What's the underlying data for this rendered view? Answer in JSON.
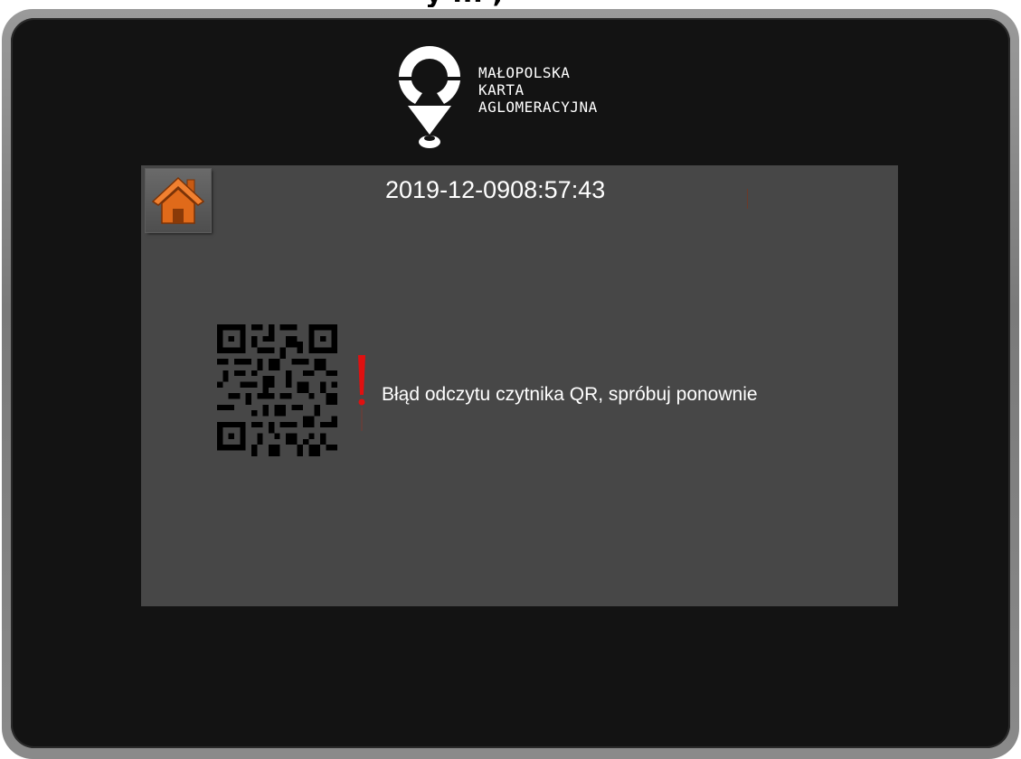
{
  "header_fragment": "y ... ,",
  "brand": {
    "lines": [
      "MAŁOPOLSKA",
      "KARTA",
      "AGLOMERACYJNA"
    ]
  },
  "status": {
    "date": "2019-12-09",
    "time": "08:57:43"
  },
  "error": {
    "message": "Błąd odczytu czytnika QR, spróbuj ponownie"
  },
  "icons": {
    "home": "home-icon",
    "qr": "qr-code-icon",
    "warning": "exclamation-icon",
    "logo": "map-pin-logo-icon"
  },
  "colors": {
    "panel": "#474747",
    "frame": "#131313",
    "home_accent": "#e06a1a",
    "warning": "#e01010",
    "text": "#ffffff"
  }
}
